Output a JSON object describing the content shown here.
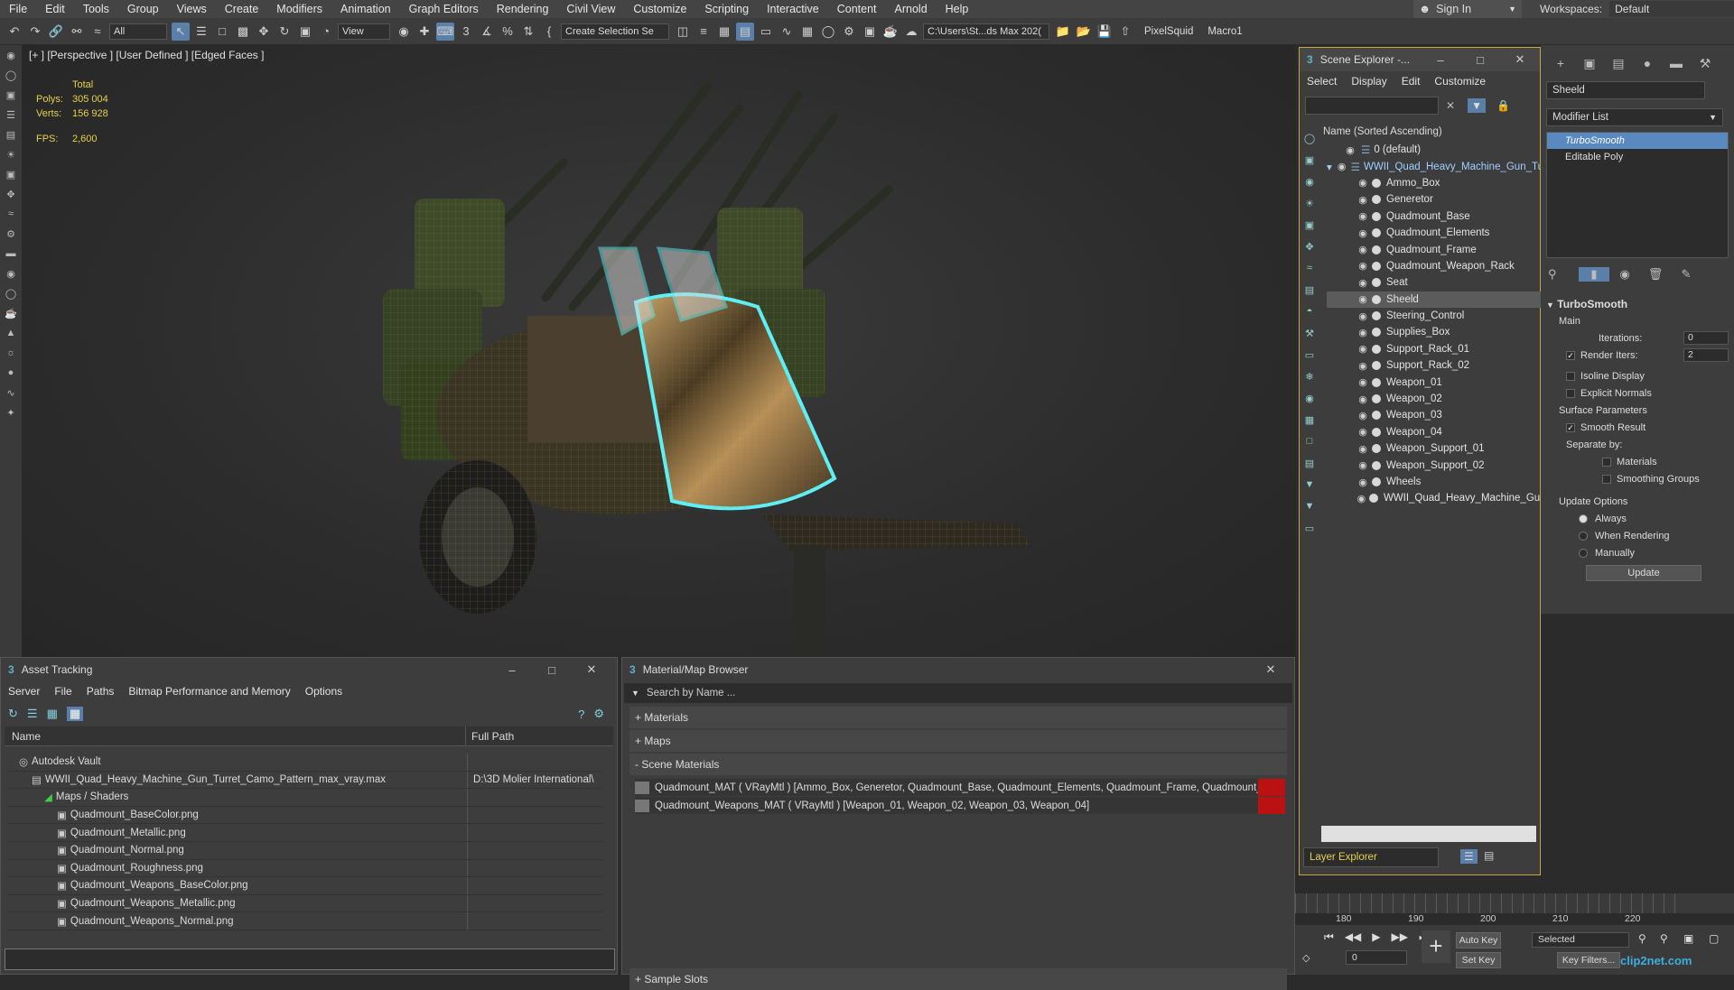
{
  "menu": [
    "File",
    "Edit",
    "Tools",
    "Group",
    "Views",
    "Create",
    "Modifiers",
    "Animation",
    "Graph Editors",
    "Rendering",
    "Civil View",
    "Customize",
    "Scripting",
    "Interactive",
    "Content",
    "Arnold",
    "Help"
  ],
  "signin": "Sign In",
  "workspace": {
    "label": "Workspaces:",
    "value": "Default"
  },
  "toolbar": {
    "filter": "All",
    "refcoord": "View",
    "selection_set": "Create Selection Se",
    "project_path": "C:\\Users\\St...ds Max 202(",
    "pixelsquid": "PixelSquid",
    "macro": "Macro1"
  },
  "viewport": {
    "label": "[+ ] [Perspective ] [User Defined ] [Edged Faces ]",
    "stats_header": "Total",
    "polys_label": "Polys:",
    "polys": "305 004",
    "verts_label": "Verts:",
    "verts": "156 928",
    "fps_label": "FPS:",
    "fps": "2,600"
  },
  "scene_explorer": {
    "title": "Scene Explorer -...",
    "menu": [
      "Select",
      "Display",
      "Edit",
      "Customize"
    ],
    "column": "Name (Sorted Ascending)",
    "layers": [
      {
        "name": "0 (default)"
      },
      {
        "name": "WWII_Quad_Heavy_Machine_Gun_Tu"
      }
    ],
    "objects": [
      "Ammo_Box",
      "Generetor",
      "Quadmount_Base",
      "Quadmount_Elements",
      "Quadmount_Frame",
      "Quadmount_Weapon_Rack",
      "Seat",
      "Sheeld",
      "Steering_Control",
      "Supplies_Box",
      "Support_Rack_01",
      "Support_Rack_02",
      "Weapon_01",
      "Weapon_02",
      "Weapon_03",
      "Weapon_04",
      "Weapon_Support_01",
      "Weapon_Support_02",
      "Wheels",
      "WWII_Quad_Heavy_Machine_Gur"
    ],
    "selected": "Sheeld",
    "layer_explorer": "Layer Explorer"
  },
  "command_panel": {
    "object_name": "Sheeld",
    "modifier_list": "Modifier List",
    "stack": [
      "TurboSmooth",
      "Editable Poly"
    ],
    "turbosmooth": {
      "title": "TurboSmooth",
      "main": "Main",
      "iterations_label": "Iterations:",
      "iterations": "0",
      "render_iters_label": "Render Iters:",
      "render_iters": "2",
      "isoline": "Isoline Display",
      "explicit": "Explicit Normals",
      "surface": "Surface Parameters",
      "smooth": "Smooth Result",
      "separate": "Separate by:",
      "materials": "Materials",
      "smoothing_groups": "Smoothing Groups",
      "update_options": "Update Options",
      "always": "Always",
      "when_rendering": "When Rendering",
      "manually": "Manually",
      "update_btn": "Update"
    }
  },
  "timeline": {
    "ticks": [
      "180",
      "190",
      "200",
      "210",
      "220"
    ],
    "autokey": "Auto Key",
    "selected": "Selected",
    "setkey": "Set Key",
    "keyfilters": "Key Filters...",
    "frame": "0"
  },
  "asset_tracking": {
    "title": "Asset Tracking",
    "menu": [
      "Server",
      "File",
      "Paths",
      "Bitmap Performance and Memory",
      "Options"
    ],
    "col_name": "Name",
    "col_path": "Full Path",
    "rows": [
      {
        "name": "Autodesk Vault",
        "path": "",
        "indent": 1
      },
      {
        "name": "WWII_Quad_Heavy_Machine_Gun_Turret_Camo_Pattern_max_vray.max",
        "path": "D:\\3D Molier International\\",
        "indent": 2
      },
      {
        "name": "Maps / Shaders",
        "path": "",
        "indent": 3
      },
      {
        "name": "Quadmount_BaseColor.png",
        "path": "",
        "indent": 4
      },
      {
        "name": "Quadmount_Metallic.png",
        "path": "",
        "indent": 4
      },
      {
        "name": "Quadmount_Normal.png",
        "path": "",
        "indent": 4
      },
      {
        "name": "Quadmount_Roughness.png",
        "path": "",
        "indent": 4
      },
      {
        "name": "Quadmount_Weapons_BaseColor.png",
        "path": "",
        "indent": 4
      },
      {
        "name": "Quadmount_Weapons_Metallic.png",
        "path": "",
        "indent": 4
      },
      {
        "name": "Quadmount_Weapons_Normal.png",
        "path": "",
        "indent": 4
      }
    ]
  },
  "material_browser": {
    "title": "Material/Map Browser",
    "search": "Search by Name ...",
    "groups": [
      "+ Materials",
      "+ Maps",
      "- Scene Materials"
    ],
    "materials": [
      "Quadmount_MAT  ( VRayMtl )  [Ammo_Box, Generetor, Quadmount_Base, Quadmount_Elements, Quadmount_Frame, Quadmount_We...",
      "Quadmount_Weapons_MAT  ( VRayMtl )  [Weapon_01, Weapon_02, Weapon_03, Weapon_04]"
    ],
    "sample_slots": "+ Sample Slots"
  },
  "watermark": "clip2net.com"
}
